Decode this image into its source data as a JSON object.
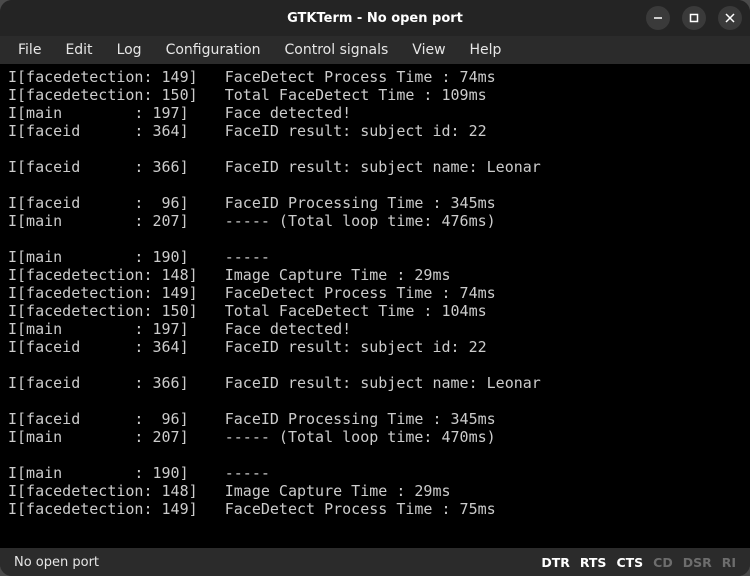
{
  "window": {
    "title": "GTKTerm - No open port"
  },
  "menu": {
    "items": [
      "File",
      "Edit",
      "Log",
      "Configuration",
      "Control signals",
      "View",
      "Help"
    ]
  },
  "terminal": {
    "lines": [
      "I[facedetection: 149]   FaceDetect Process Time : 74ms",
      "I[facedetection: 150]   Total FaceDetect Time : 109ms",
      "I[main        : 197]    Face detected!",
      "I[faceid      : 364]    FaceID result: subject id: 22",
      "",
      "I[faceid      : 366]    FaceID result: subject name: Leonar",
      "",
      "I[faceid      :  96]    FaceID Processing Time : 345ms",
      "I[main        : 207]    ----- (Total loop time: 476ms)",
      "",
      "I[main        : 190]    -----",
      "I[facedetection: 148]   Image Capture Time : 29ms",
      "I[facedetection: 149]   FaceDetect Process Time : 74ms",
      "I[facedetection: 150]   Total FaceDetect Time : 104ms",
      "I[main        : 197]    Face detected!",
      "I[faceid      : 364]    FaceID result: subject id: 22",
      "",
      "I[faceid      : 366]    FaceID result: subject name: Leonar",
      "",
      "I[faceid      :  96]    FaceID Processing Time : 345ms",
      "I[main        : 207]    ----- (Total loop time: 470ms)",
      "",
      "I[main        : 190]    -----",
      "I[facedetection: 148]   Image Capture Time : 29ms",
      "I[facedetection: 149]   FaceDetect Process Time : 75ms"
    ]
  },
  "statusbar": {
    "left": "No open port",
    "signals": [
      {
        "label": "DTR",
        "active": true
      },
      {
        "label": "RTS",
        "active": true
      },
      {
        "label": "CTS",
        "active": true
      },
      {
        "label": "CD",
        "active": false
      },
      {
        "label": "DSR",
        "active": false
      },
      {
        "label": "RI",
        "active": false
      }
    ]
  }
}
